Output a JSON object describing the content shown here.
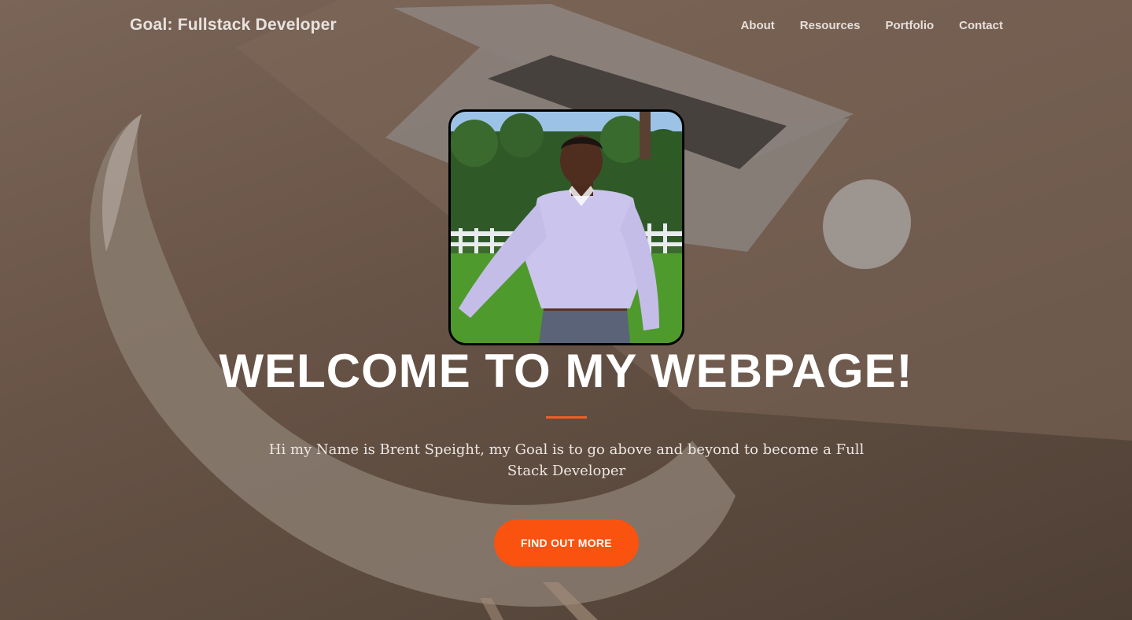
{
  "navbar": {
    "brand": "Goal: Fullstack Developer",
    "links": [
      {
        "label": "About"
      },
      {
        "label": "Resources"
      },
      {
        "label": "Portfolio"
      },
      {
        "label": "Contact"
      }
    ]
  },
  "hero": {
    "headline": "WELCOME TO MY WEBPAGE!",
    "intro": "Hi my Name is Brent Speight, my Goal is to go above and beyond to become a Full Stack Developer",
    "cta_label": "FIND OUT MORE"
  },
  "colors": {
    "accent": "#fa520f",
    "overlay": "#5b4a3e",
    "text": "#ffffff"
  }
}
